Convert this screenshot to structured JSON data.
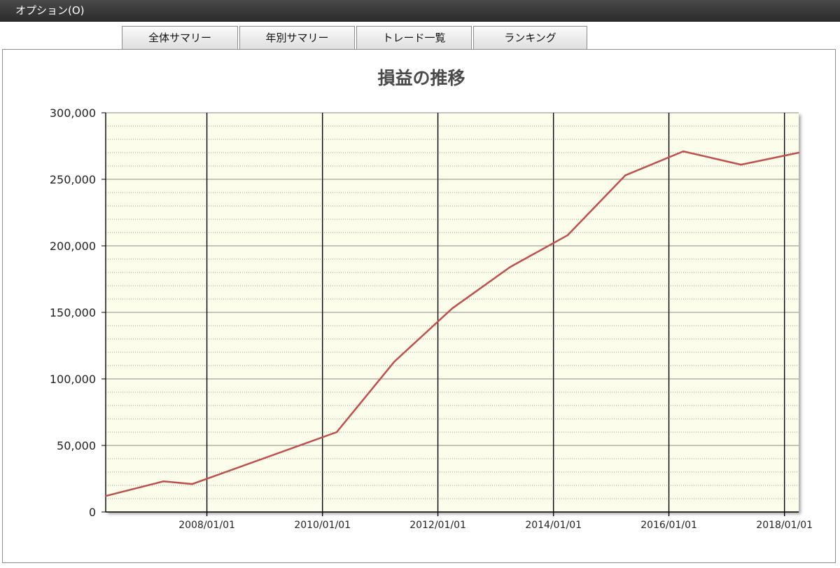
{
  "menubar": {
    "option_label": "オプション(O)"
  },
  "tabs": [
    {
      "label": "全体サマリー"
    },
    {
      "label": "年別サマリー"
    },
    {
      "label": "トレード一覧"
    },
    {
      "label": "ランキング"
    }
  ],
  "colors": {
    "plot_background": "#fdfdec",
    "line": "#c0504d",
    "menubar": "#333333"
  },
  "chart_data": {
    "type": "line",
    "title": "損益の推移",
    "xlabel": "",
    "ylabel": "",
    "x_tick_labels": [
      "2008/01/01",
      "2010/01/01",
      "2012/01/01",
      "2014/01/01",
      "2016/01/01",
      "2018/01/01"
    ],
    "y_tick_labels": [
      "0",
      "50,000",
      "100,000",
      "150,000",
      "200,000",
      "250,000",
      "300,000"
    ],
    "ylim": [
      0,
      300000
    ],
    "xlim": [
      "2006/04/01",
      "2018/04/01"
    ],
    "grid": true,
    "series": [
      {
        "x": [
          "2006/04/01",
          "2007/04/01",
          "2007/10/01",
          "2010/04/01",
          "2011/04/01",
          "2012/04/01",
          "2013/04/01",
          "2014/04/01",
          "2015/04/01",
          "2016/04/01",
          "2017/04/01",
          "2018/04/01"
        ],
        "y": [
          12000,
          23000,
          21000,
          60000,
          113000,
          153000,
          184000,
          208000,
          253000,
          271000,
          261000,
          270000
        ]
      }
    ]
  }
}
